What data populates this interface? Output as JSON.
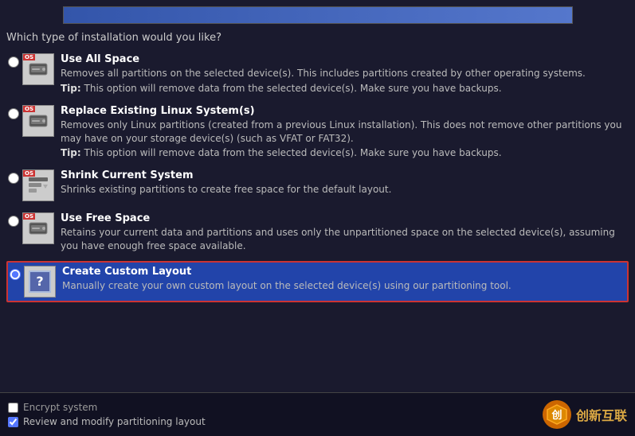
{
  "header": {
    "progress_fill": "100%"
  },
  "question": "Which type of installation would you like?",
  "options": [
    {
      "id": "use-all-space",
      "title": "Use All Space",
      "desc": "Removes all partitions on the selected device(s).  This includes partitions created by other operating systems.",
      "tip": "This option will remove data from the selected device(s).  Make sure you have backups.",
      "selected": false,
      "icon_type": "hdd",
      "has_os_badge": true
    },
    {
      "id": "replace-linux",
      "title": "Replace Existing Linux System(s)",
      "desc": "Removes only Linux partitions (created from a previous Linux installation).  This does not remove other partitions you may have on your storage device(s) (such as VFAT or FAT32).",
      "tip": "This option will remove data from the selected device(s).  Make sure you have backups.",
      "selected": false,
      "icon_type": "hdd",
      "has_os_badge": true
    },
    {
      "id": "shrink-current",
      "title": "Shrink Current System",
      "desc": "Shrinks existing partitions to create free space for the default layout.",
      "tip": "",
      "selected": false,
      "icon_type": "shrink",
      "has_os_badge": true
    },
    {
      "id": "use-free-space",
      "title": "Use Free Space",
      "desc": "Retains your current data and partitions and uses only the unpartitioned space on the selected device(s), assuming you have enough free space available.",
      "tip": "",
      "selected": false,
      "icon_type": "hdd",
      "has_os_badge": true
    },
    {
      "id": "create-custom",
      "title": "Create Custom Layout",
      "desc": "Manually create your own custom layout on the selected device(s) using our partitioning tool.",
      "tip": "",
      "selected": true,
      "icon_type": "question",
      "has_os_badge": false
    }
  ],
  "bottom": {
    "encrypt_label": "Encrypt system",
    "encrypt_checked": false,
    "review_label": "Review and modify partitioning layout",
    "review_checked": true
  },
  "brand": {
    "name": "创新互联",
    "icon_symbol": "★"
  }
}
